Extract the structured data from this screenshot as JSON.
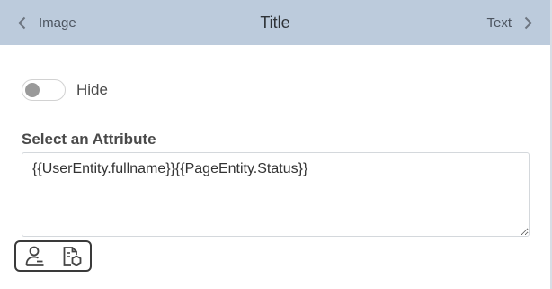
{
  "header": {
    "prev_label": "Image",
    "title": "Title",
    "next_label": "Text"
  },
  "visibility": {
    "toggle_label": "Hide",
    "enabled": false
  },
  "attribute": {
    "label": "Select an Attribute",
    "value": "{{UserEntity.fullname}}{{PageEntity.Status}}"
  },
  "toolbar": {
    "icons": [
      "user-entity-icon",
      "page-entity-icon"
    ]
  },
  "colors": {
    "header_bg": "#bccbdc",
    "toolbar_border": "#3a3a3a"
  }
}
